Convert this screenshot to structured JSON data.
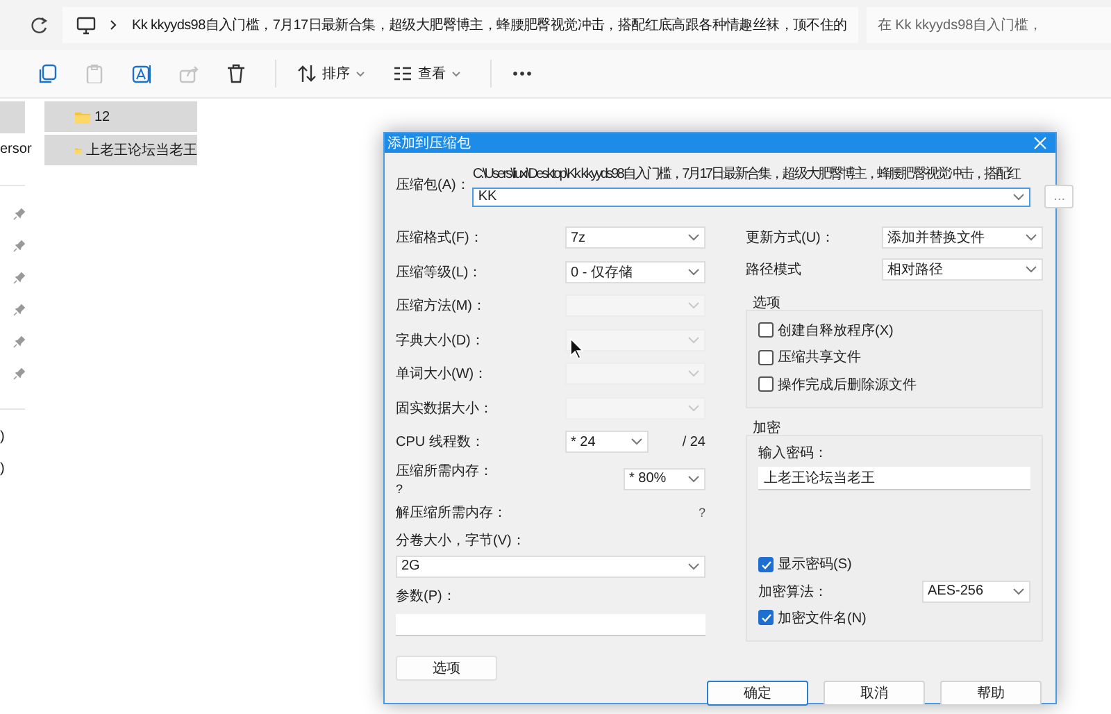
{
  "address_bar": {
    "path": "Kk kkyyds98自入门槛，7月17日最新合集，超级大肥臀博主，蜂腰肥臀视觉冲击，搭配红底高跟各种情趣丝袜，顶不住的",
    "search_placeholder": "在 Kk kkyyds98自入门槛，"
  },
  "toolbar": {
    "buttons": [
      {
        "kind": "copy",
        "disabled": false
      },
      {
        "kind": "paste",
        "disabled": true
      },
      {
        "kind": "rename",
        "disabled": false
      },
      {
        "kind": "share",
        "disabled": true
      },
      {
        "kind": "delete",
        "disabled": false
      },
      {
        "kind": "sort",
        "label": "排序",
        "disabled": false
      },
      {
        "kind": "view",
        "label": "查看",
        "disabled": false
      },
      {
        "kind": "more",
        "disabled": false
      }
    ]
  },
  "sidebar": {
    "items": [
      {
        "kind": "blank",
        "selected": true
      },
      {
        "kind": "text",
        "label": "ersor",
        "selected": false
      },
      {
        "kind": "divider",
        "selected": false
      },
      {
        "kind": "pinned",
        "selected": false
      },
      {
        "kind": "pinned",
        "selected": false
      },
      {
        "kind": "pinned",
        "selected": false
      },
      {
        "kind": "pinned",
        "selected": false
      },
      {
        "kind": "pinned",
        "selected": false
      },
      {
        "kind": "pinned",
        "selected": false
      },
      {
        "kind": "divider",
        "selected": false
      },
      {
        "kind": "text",
        "label": ")",
        "selected": false
      },
      {
        "kind": "text",
        "label": ")",
        "selected": false
      }
    ]
  },
  "files": [
    {
      "name": "12",
      "selected": true
    },
    {
      "name": "上老王论坛当老王",
      "selected": true
    }
  ],
  "dialog": {
    "title": "添加到压缩包",
    "archive": {
      "label": "压缩包(A)：",
      "path": "C:\\Users\\liuxi\\Desktop\\Kk kkyyds98自入门槛，7月17日最新合集，超级大肥臀博主，蜂腰肥臀视觉冲击，搭配红",
      "value": "KK",
      "browse": "..."
    },
    "left_fields": [
      {
        "kind": "select",
        "label": "压缩格式(F)：",
        "value": "7z",
        "disabled": false
      },
      {
        "kind": "select",
        "label": "压缩等级(L)：",
        "value": "0 - 仅存储",
        "disabled": false
      },
      {
        "kind": "select",
        "label": "压缩方法(M)：",
        "disabled": true
      },
      {
        "kind": "select",
        "label": "字典大小(D)：",
        "disabled": true
      },
      {
        "kind": "select",
        "label": "单词大小(W)：",
        "disabled": true
      },
      {
        "kind": "select",
        "label": "固实数据大小：",
        "disabled": true
      },
      {
        "kind": "threads",
        "label": "CPU 线程数：",
        "value": "* 24",
        "note": "/ 24"
      },
      {
        "kind": "memory",
        "label": "压缩所需内存：",
        "value": "* 80%",
        "note": "?"
      },
      {
        "kind": "info",
        "label": "解压缩所需内存：",
        "note": "?"
      },
      {
        "kind": "wide_select",
        "label": "分卷大小，字节(V)：",
        "value": "2G"
      },
      {
        "kind": "text_input",
        "label": "参数(P)："
      }
    ],
    "options_button": "选项",
    "update_mode": {
      "label": "更新方式(U)：",
      "value": "添加并替换文件"
    },
    "path_mode": {
      "label": "路径模式",
      "value": "相对路径"
    },
    "options_group": {
      "title": "选项",
      "checkboxes": [
        {
          "label": "创建自释放程序(X)",
          "checked": false
        },
        {
          "label": "压缩共享文件",
          "checked": false
        },
        {
          "label": "操作完成后删除源文件",
          "checked": false
        }
      ]
    },
    "encryption": {
      "title": "加密",
      "password_label": "输入密码：",
      "password": "上老王论坛当老王",
      "show_password": {
        "label": "显示密码(S)",
        "checked": true
      },
      "method_label": "加密算法：",
      "method": "AES-256",
      "encrypt_names": {
        "label": "加密文件名(N)",
        "checked": true
      }
    },
    "buttons": [
      {
        "label": "确定",
        "default": true
      },
      {
        "label": "取消",
        "default": false
      },
      {
        "label": "帮助",
        "default": false
      }
    ]
  }
}
